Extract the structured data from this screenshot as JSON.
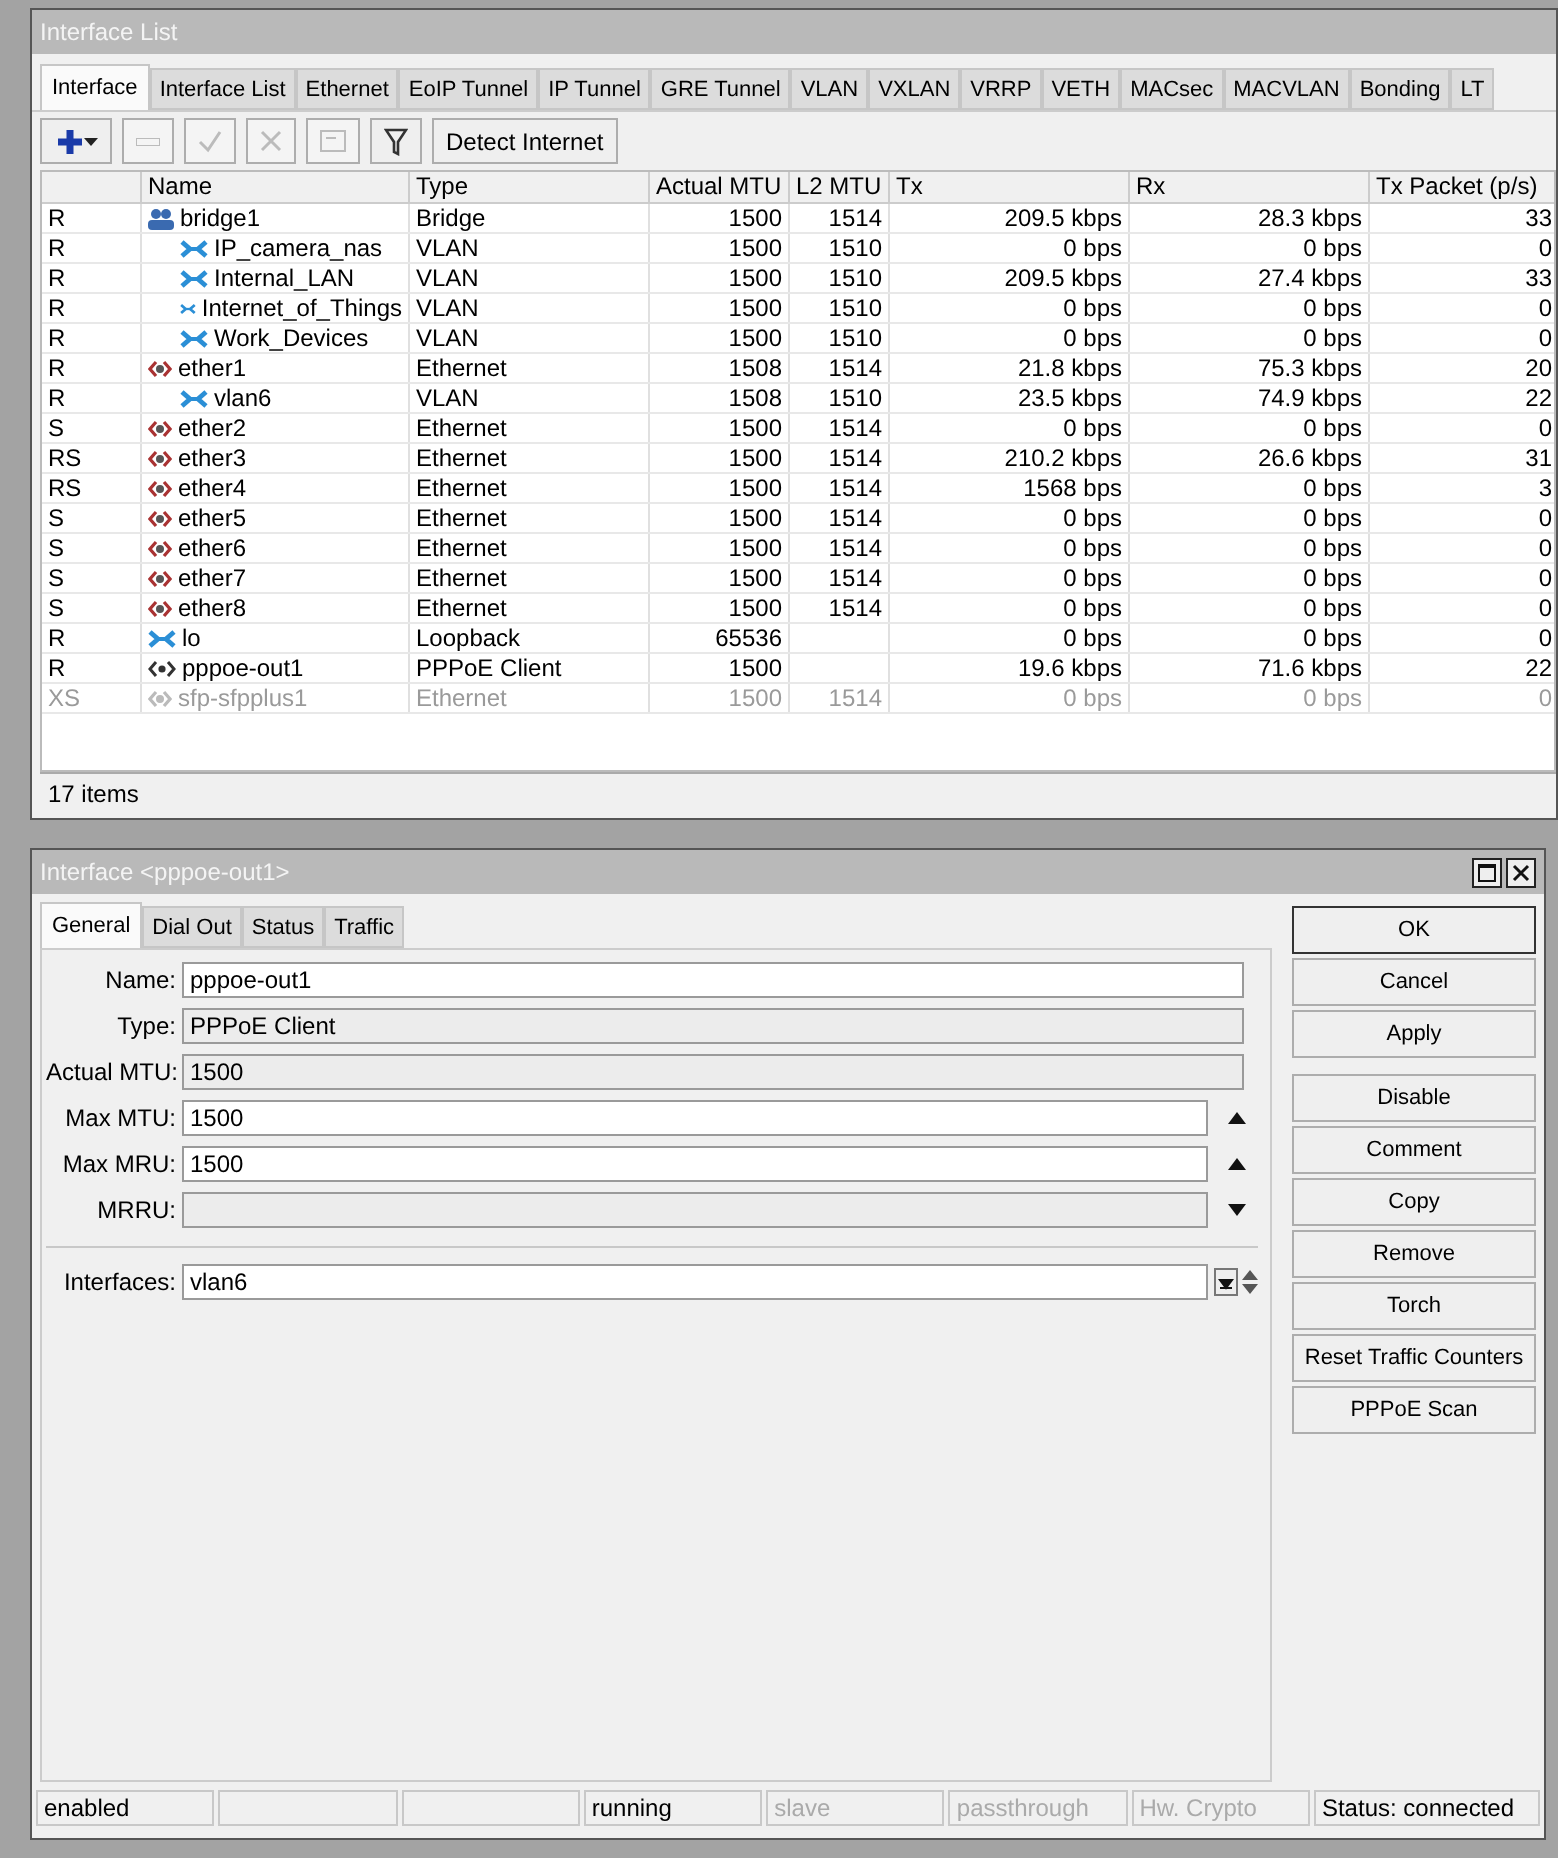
{
  "list_window": {
    "title": "Interface List",
    "tabs": [
      {
        "label": "Interface",
        "selected": true
      },
      {
        "label": "Interface List",
        "selected": false
      },
      {
        "label": "Ethernet",
        "selected": false
      },
      {
        "label": "EoIP Tunnel",
        "selected": false
      },
      {
        "label": "IP Tunnel",
        "selected": false
      },
      {
        "label": "GRE Tunnel",
        "selected": false
      },
      {
        "label": "VLAN",
        "selected": false
      },
      {
        "label": "VXLAN",
        "selected": false
      },
      {
        "label": "VRRP",
        "selected": false
      },
      {
        "label": "VETH",
        "selected": false
      },
      {
        "label": "MACsec",
        "selected": false
      },
      {
        "label": "MACVLAN",
        "selected": false
      },
      {
        "label": "Bonding",
        "selected": false
      },
      {
        "label": "LT",
        "selected": false
      }
    ],
    "toolbar": [
      {
        "kind": "add",
        "disabled": false
      },
      {
        "kind": "remove",
        "disabled": true
      },
      {
        "kind": "enable",
        "disabled": true
      },
      {
        "kind": "disable",
        "disabled": true
      },
      {
        "kind": "comment",
        "disabled": true
      },
      {
        "kind": "filter",
        "disabled": false
      },
      {
        "kind": "text",
        "label": "Detect Internet",
        "disabled": false
      }
    ],
    "table": {
      "columns": [
        "",
        "Name",
        "Type",
        "Actual MTU",
        "L2 MTU",
        "Tx",
        "Rx",
        "Tx Packet (p/s)"
      ],
      "rows": [
        {
          "flags": "R",
          "name": "bridge1",
          "kind": "bridge",
          "type": "Bridge",
          "actual_mtu": "1500",
          "l2_mtu": "1514",
          "tx": "209.5 kbps",
          "rx": "28.3 kbps",
          "tx_packet": "33",
          "disabled": false,
          "children": [
            {
              "flags": "R",
              "name": "IP_camera_nas",
              "kind": "vlan",
              "type": "VLAN",
              "actual_mtu": "1500",
              "l2_mtu": "1510",
              "tx": "0 bps",
              "rx": "0 bps",
              "tx_packet": "0",
              "disabled": false
            },
            {
              "flags": "R",
              "name": "Internal_LAN",
              "kind": "vlan",
              "type": "VLAN",
              "actual_mtu": "1500",
              "l2_mtu": "1510",
              "tx": "209.5 kbps",
              "rx": "27.4 kbps",
              "tx_packet": "33",
              "disabled": false
            },
            {
              "flags": "R",
              "name": "Internet_of_Things",
              "kind": "vlan",
              "type": "VLAN",
              "actual_mtu": "1500",
              "l2_mtu": "1510",
              "tx": "0 bps",
              "rx": "0 bps",
              "tx_packet": "0",
              "disabled": false
            },
            {
              "flags": "R",
              "name": "Work_Devices",
              "kind": "vlan",
              "type": "VLAN",
              "actual_mtu": "1500",
              "l2_mtu": "1510",
              "tx": "0 bps",
              "rx": "0 bps",
              "tx_packet": "0",
              "disabled": false
            }
          ]
        },
        {
          "flags": "R",
          "name": "ether1",
          "kind": "ethernet",
          "type": "Ethernet",
          "actual_mtu": "1508",
          "l2_mtu": "1514",
          "tx": "21.8 kbps",
          "rx": "75.3 kbps",
          "tx_packet": "20",
          "disabled": false,
          "children": [
            {
              "flags": "R",
              "name": "vlan6",
              "kind": "vlan",
              "type": "VLAN",
              "actual_mtu": "1508",
              "l2_mtu": "1510",
              "tx": "23.5 kbps",
              "rx": "74.9 kbps",
              "tx_packet": "22",
              "disabled": false
            }
          ]
        },
        {
          "flags": "S",
          "name": "ether2",
          "kind": "ethernet",
          "type": "Ethernet",
          "actual_mtu": "1500",
          "l2_mtu": "1514",
          "tx": "0 bps",
          "rx": "0 bps",
          "tx_packet": "0",
          "disabled": false
        },
        {
          "flags": "RS",
          "name": "ether3",
          "kind": "ethernet",
          "type": "Ethernet",
          "actual_mtu": "1500",
          "l2_mtu": "1514",
          "tx": "210.2 kbps",
          "rx": "26.6 kbps",
          "tx_packet": "31",
          "disabled": false
        },
        {
          "flags": "RS",
          "name": "ether4",
          "kind": "ethernet",
          "type": "Ethernet",
          "actual_mtu": "1500",
          "l2_mtu": "1514",
          "tx": "1568 bps",
          "rx": "0 bps",
          "tx_packet": "3",
          "disabled": false
        },
        {
          "flags": "S",
          "name": "ether5",
          "kind": "ethernet",
          "type": "Ethernet",
          "actual_mtu": "1500",
          "l2_mtu": "1514",
          "tx": "0 bps",
          "rx": "0 bps",
          "tx_packet": "0",
          "disabled": false
        },
        {
          "flags": "S",
          "name": "ether6",
          "kind": "ethernet",
          "type": "Ethernet",
          "actual_mtu": "1500",
          "l2_mtu": "1514",
          "tx": "0 bps",
          "rx": "0 bps",
          "tx_packet": "0",
          "disabled": false
        },
        {
          "flags": "S",
          "name": "ether7",
          "kind": "ethernet",
          "type": "Ethernet",
          "actual_mtu": "1500",
          "l2_mtu": "1514",
          "tx": "0 bps",
          "rx": "0 bps",
          "tx_packet": "0",
          "disabled": false
        },
        {
          "flags": "S",
          "name": "ether8",
          "kind": "ethernet",
          "type": "Ethernet",
          "actual_mtu": "1500",
          "l2_mtu": "1514",
          "tx": "0 bps",
          "rx": "0 bps",
          "tx_packet": "0",
          "disabled": false
        },
        {
          "flags": "R",
          "name": "lo",
          "kind": "vlan",
          "type": "Loopback",
          "actual_mtu": "65536",
          "tx": "0 bps",
          "rx": "0 bps",
          "tx_packet": "0",
          "disabled": false
        },
        {
          "flags": "R",
          "name": "pppoe-out1",
          "kind": "pppoe",
          "type": "PPPoE Client",
          "actual_mtu": "1500",
          "tx": "19.6 kbps",
          "rx": "71.6 kbps",
          "tx_packet": "22",
          "disabled": false
        },
        {
          "flags": "XS",
          "name": "sfp-sfpplus1",
          "kind": "ethernet",
          "type": "Ethernet",
          "actual_mtu": "1500",
          "l2_mtu": "1514",
          "tx": "0 bps",
          "rx": "0 bps",
          "tx_packet": "0",
          "disabled": true
        }
      ]
    },
    "item_count": "17 items"
  },
  "dialog": {
    "title": "Interface <pppoe-out1>",
    "tabs": [
      {
        "label": "General",
        "selected": true
      },
      {
        "label": "Dial Out",
        "selected": false
      },
      {
        "label": "Status",
        "selected": false
      },
      {
        "label": "Traffic",
        "selected": false
      }
    ],
    "fields": [
      {
        "label": "Name:",
        "value": "pppoe-out1",
        "editable": true,
        "kind": "plain"
      },
      {
        "label": "Type:",
        "value": "PPPoE Client",
        "editable": false,
        "kind": "plain"
      },
      {
        "label": "Actual MTU:",
        "value": "1500",
        "editable": false,
        "kind": "plain"
      },
      {
        "label": "Max MTU:",
        "value": "1500",
        "editable": true,
        "kind": "up"
      },
      {
        "label": "Max MRU:",
        "value": "1500",
        "editable": true,
        "kind": "up"
      },
      {
        "label": "MRRU:",
        "editable": false,
        "kind": "down"
      },
      {
        "label": "Interfaces:",
        "value": "vlan6",
        "editable": true,
        "kind": "select"
      }
    ],
    "button_groups": [
      [
        {
          "label": "OK",
          "default": true
        },
        {
          "label": "Cancel",
          "default": false
        },
        {
          "label": "Apply",
          "default": false
        }
      ],
      [
        {
          "label": "Disable",
          "default": false
        },
        {
          "label": "Comment",
          "default": false
        },
        {
          "label": "Copy",
          "default": false
        },
        {
          "label": "Remove",
          "default": false
        },
        {
          "label": "Torch",
          "default": false
        },
        {
          "label": "Reset Traffic Counters",
          "default": false
        },
        {
          "label": "PPPoE Scan",
          "default": false
        }
      ]
    ],
    "status_bar": [
      {
        "kind": "text",
        "text": "enabled",
        "disabled": false
      },
      {
        "kind": "blank"
      },
      {
        "kind": "blank"
      },
      {
        "kind": "text",
        "text": "running",
        "disabled": false
      },
      {
        "kind": "text",
        "text": "slave",
        "disabled": true
      },
      {
        "kind": "text",
        "text": "passthrough",
        "disabled": true
      },
      {
        "kind": "text",
        "text": "Hw. Crypto",
        "disabled": true
      },
      {
        "kind": "text",
        "text": "Status: connected",
        "disabled": false
      }
    ]
  }
}
